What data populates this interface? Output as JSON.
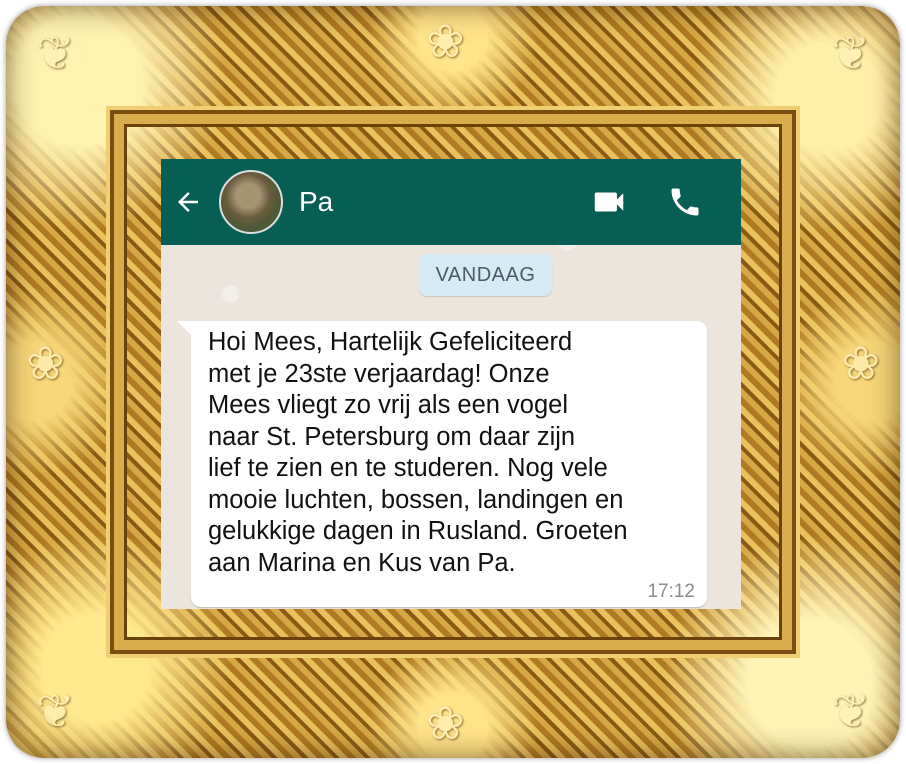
{
  "header": {
    "contact_name": "Pa",
    "back_icon": "arrow-left-icon",
    "video_icon": "video-camera-icon",
    "call_icon": "phone-icon",
    "bar_color": "#075e54"
  },
  "chat": {
    "date_label": "VANDAAG",
    "messages": [
      {
        "text": "Hoi Mees, Hartelijk Gefeliciteerd\nmet je 23ste verjaardag! Onze\nMees vliegt zo vrij als een vogel\nnaar St. Petersburg om daar  zijn\nlief te zien en te studeren. Nog vele\nmooie luchten, bossen, landingen en\ngelukkige dagen in Rusland. Groeten\naan Marina en Kus van Pa.",
        "time": "17:12"
      }
    ]
  },
  "frame": {
    "color": "#c8922e"
  }
}
